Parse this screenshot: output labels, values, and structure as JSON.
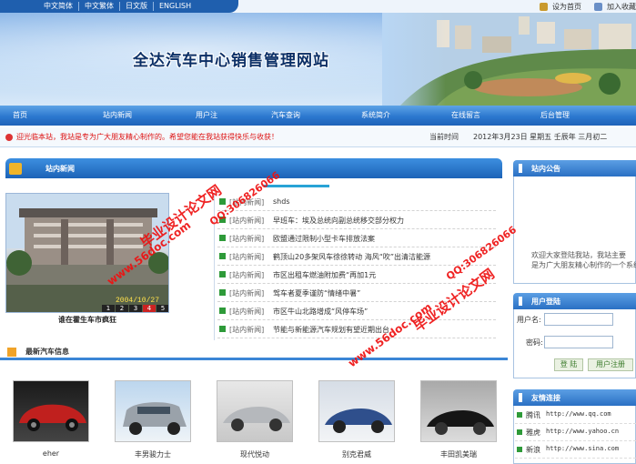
{
  "top_bar": {
    "languages": [
      "中文简体",
      "中文繁体",
      "日文版",
      "ENGLISH"
    ],
    "set_home": "设为首页",
    "add_favorite": "加入收藏"
  },
  "banner": {
    "title": "全达汽车中心销售管理网站"
  },
  "nav": {
    "items": [
      "首页",
      "站内新闻",
      "用户注册",
      "汽车查询",
      "系统简介",
      "在线留言",
      "后台管理"
    ]
  },
  "notice_bar": {
    "text": "迎光临本站，我站是专为广大朋友精心制作的。希望您能在我站获得快乐与收获！",
    "date_label": "当前时间",
    "date": "2012年3月23日 星期五 壬辰年 三月初二"
  },
  "news": {
    "title": "站内新闻",
    "photo_date": "2004/10/27",
    "photo_pages": [
      "1",
      "2",
      "3",
      "4",
      "5"
    ],
    "photo_active_page": 4,
    "photo_caption": "谁在霍生车市疯狂",
    "items": [
      {
        "tag": "[站内新闻]",
        "text": "shds"
      },
      {
        "tag": "[站内新闻]",
        "text": "早班车：埃及总统向副总统移交部分权力"
      },
      {
        "tag": "[站内新闻]",
        "text": "欧盟通过限制小型卡车排放法案"
      },
      {
        "tag": "[站内新闻]",
        "text": "鹤顶山20多架风车徐徐转动 海风“吹”出清洁能源"
      },
      {
        "tag": "[站内新闻]",
        "text": "市区出租车燃油附加费“再加1元"
      },
      {
        "tag": "[站内新闻]",
        "text": "驾车者夏季谨防“情绪中暑”"
      },
      {
        "tag": "[站内新闻]",
        "text": "市区牛山北路增成“风停车场”"
      },
      {
        "tag": "[站内新闻]",
        "text": "节能与新能源汽车规划有望近期出台"
      }
    ]
  },
  "announcement": {
    "title": "站内公告",
    "text_line1": "欢迎大家登陆我站，我站主要",
    "text_line2": "是为广大朋友精心制作的一个系统"
  },
  "login": {
    "title": "用户登陆",
    "username_label": "用户名:",
    "password_label": "密码:",
    "login_button": "登 陆",
    "register_button": "用户注册"
  },
  "links": {
    "title": "友情连接",
    "items": [
      {
        "name": "腾讯",
        "url": "http://www.qq.com"
      },
      {
        "name": "雅虎",
        "url": "http://www.yahoo.cn"
      },
      {
        "name": "新浪",
        "url": "http://www.sina.com"
      }
    ]
  },
  "cars": {
    "title": "最新汽车信息",
    "items": [
      "eher",
      "丰男骏力士",
      "现代悦动",
      "别克君威",
      "丰田凯美瑞"
    ]
  },
  "watermarks": {
    "title": "毕业设计论文网",
    "url": "www.56doc.com",
    "qq": "QQ:306826066"
  },
  "colors": {
    "nav_blue": "#2c78cf",
    "notice_red": "#d11",
    "watermark_red": "#ee1111",
    "accent_green": "#2e9a39"
  }
}
